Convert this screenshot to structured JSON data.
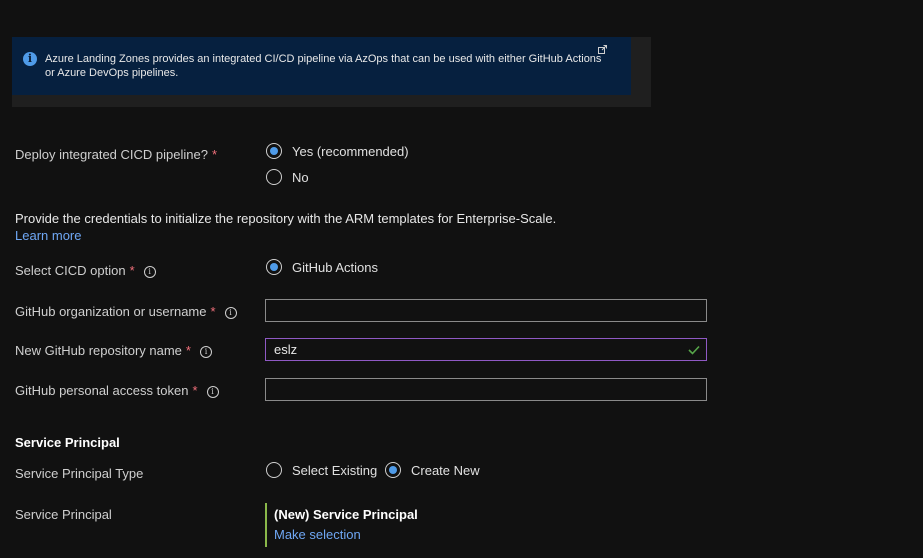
{
  "banner": {
    "text": "Azure Landing Zones provides an integrated CI/CD pipeline via AzOps that can be used with either GitHub Actions or Azure DevOps pipelines."
  },
  "deploy_pipeline": {
    "label": "Deploy integrated CICD pipeline?",
    "required_mark": "*",
    "options": [
      "Yes (recommended)",
      "No"
    ],
    "selected": "Yes (recommended)"
  },
  "credentials": {
    "description": "Provide the credentials to initialize the repository with the ARM templates for Enterprise-Scale.",
    "learn_more": "Learn more"
  },
  "cicd_option": {
    "label": "Select CICD option",
    "required_mark": "*",
    "options": [
      "GitHub Actions"
    ],
    "selected": "GitHub Actions"
  },
  "github_org": {
    "label": "GitHub organization or username",
    "required_mark": "*",
    "value": ""
  },
  "repo_name": {
    "label": "New GitHub repository name",
    "required_mark": "*",
    "value": "eslz"
  },
  "access_token": {
    "label": "GitHub personal access token",
    "required_mark": "*",
    "value": ""
  },
  "service_principal": {
    "section_title": "Service Principal",
    "type_label": "Service Principal Type",
    "type_options": [
      "Select Existing",
      "Create New"
    ],
    "type_selected": "Create New",
    "label": "Service Principal",
    "selected_name": "(New) Service Principal",
    "make_selection": "Make selection"
  },
  "colors": {
    "background": "#111111",
    "banner": "#06203f",
    "accent": "#4f9be8",
    "link": "#6fa7f4",
    "required": "#f1707b",
    "valid_border": "#8f59c4",
    "valid_check": "#57a64a",
    "selection_bar": "#8ab84a"
  }
}
